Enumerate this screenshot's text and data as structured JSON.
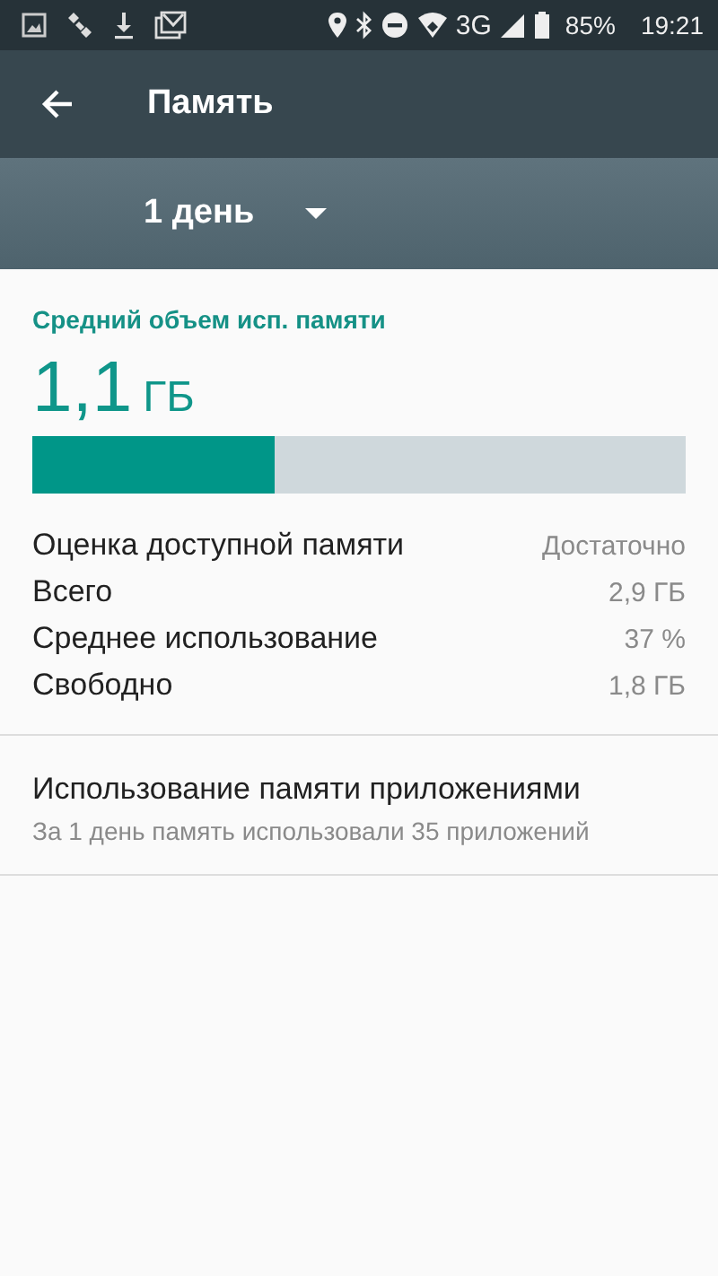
{
  "status_bar": {
    "network": "3G",
    "battery": "85%",
    "time": "19:21"
  },
  "toolbar": {
    "title": "Память"
  },
  "period_dropdown": {
    "value": "1 день"
  },
  "memory": {
    "heading": "Средний объем исп. памяти",
    "amount": "1,1",
    "unit": "ГБ",
    "level": 0.37,
    "stats": [
      {
        "label": "Оценка доступной памяти",
        "value": "Достаточно"
      },
      {
        "label": "Всего",
        "value": "2,9 ГБ"
      },
      {
        "label": "Среднее использование",
        "value": "37 %"
      },
      {
        "label": "Свободно",
        "value": "1,8 ГБ"
      }
    ]
  },
  "app_usage": {
    "title": "Использование памяти приложениями",
    "subtitle": "За 1 день память использовали 35 приложений"
  }
}
